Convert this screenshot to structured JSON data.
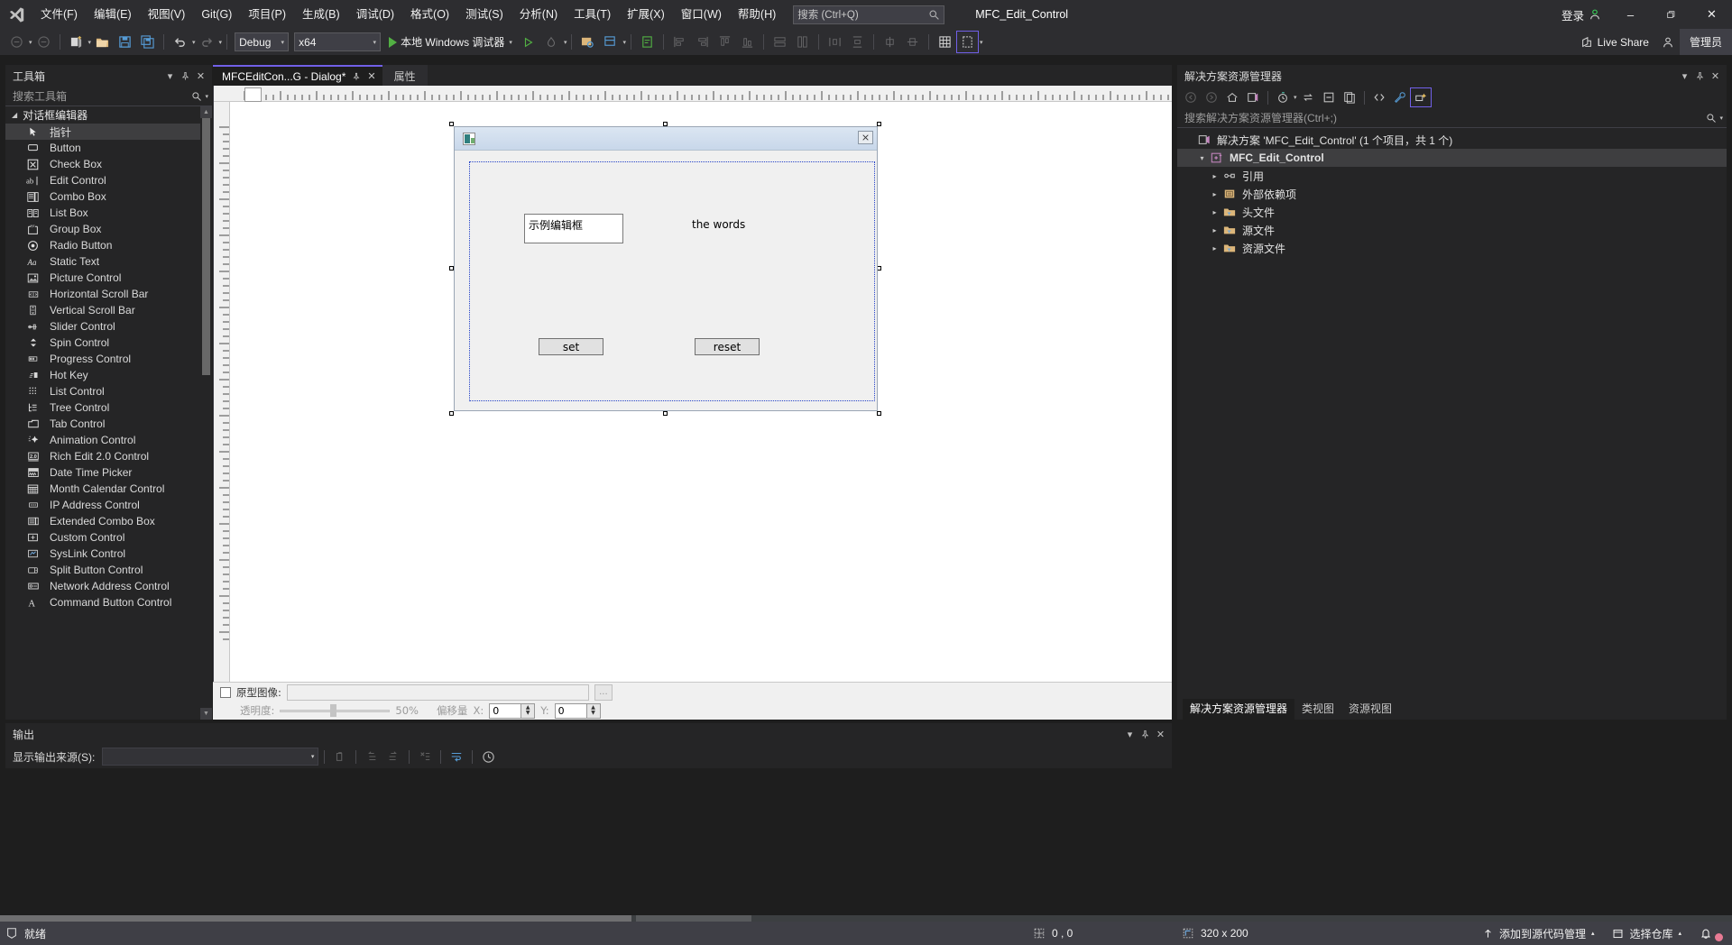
{
  "app": {
    "window_title": "MFC_Edit_Control",
    "signin_label": "登录",
    "minimize": "–",
    "restore": "❐",
    "close": "✕"
  },
  "menubar": {
    "items": [
      "文件(F)",
      "编辑(E)",
      "视图(V)",
      "Git(G)",
      "项目(P)",
      "生成(B)",
      "调试(D)",
      "格式(O)",
      "测试(S)",
      "分析(N)",
      "工具(T)",
      "扩展(X)",
      "窗口(W)",
      "帮助(H)"
    ],
    "search_placeholder": "搜索 (Ctrl+Q)"
  },
  "toolbar": {
    "config": "Debug",
    "platform": "x64",
    "run_label": "本地 Windows 调试器",
    "live_share": "Live Share",
    "admin": "管理员"
  },
  "toolbox": {
    "title": "工具箱",
    "search_placeholder": "搜索工具箱",
    "group": "对话框编辑器",
    "items": [
      {
        "label": "指针",
        "icon": "pointer-icon",
        "selected": true
      },
      {
        "label": "Button",
        "icon": "button-icon",
        "selected": false
      },
      {
        "label": "Check Box",
        "icon": "checkbox-icon",
        "selected": false
      },
      {
        "label": "Edit Control",
        "icon": "edit-control-icon",
        "selected": false
      },
      {
        "label": "Combo Box",
        "icon": "combobox-icon",
        "selected": false
      },
      {
        "label": "List Box",
        "icon": "listbox-icon",
        "selected": false
      },
      {
        "label": "Group Box",
        "icon": "groupbox-icon",
        "selected": false
      },
      {
        "label": "Radio Button",
        "icon": "radio-button-icon",
        "selected": false
      },
      {
        "label": "Static Text",
        "icon": "static-text-icon",
        "selected": false
      },
      {
        "label": "Picture Control",
        "icon": "picture-control-icon",
        "selected": false
      },
      {
        "label": "Horizontal Scroll Bar",
        "icon": "hscrollbar-icon",
        "selected": false
      },
      {
        "label": "Vertical Scroll Bar",
        "icon": "vscrollbar-icon",
        "selected": false
      },
      {
        "label": "Slider Control",
        "icon": "slider-icon",
        "selected": false
      },
      {
        "label": "Spin Control",
        "icon": "spin-icon",
        "selected": false
      },
      {
        "label": "Progress Control",
        "icon": "progress-icon",
        "selected": false
      },
      {
        "label": "Hot Key",
        "icon": "hotkey-icon",
        "selected": false
      },
      {
        "label": "List Control",
        "icon": "list-control-icon",
        "selected": false
      },
      {
        "label": "Tree Control",
        "icon": "tree-control-icon",
        "selected": false
      },
      {
        "label": "Tab Control",
        "icon": "tab-control-icon",
        "selected": false
      },
      {
        "label": "Animation Control",
        "icon": "animation-icon",
        "selected": false
      },
      {
        "label": "Rich Edit 2.0 Control",
        "icon": "rich-edit-icon",
        "selected": false
      },
      {
        "label": "Date Time Picker",
        "icon": "datetime-picker-icon",
        "selected": false
      },
      {
        "label": "Month Calendar Control",
        "icon": "calendar-icon",
        "selected": false
      },
      {
        "label": "IP Address Control",
        "icon": "ip-address-icon",
        "selected": false
      },
      {
        "label": "Extended Combo Box",
        "icon": "ext-combobox-icon",
        "selected": false
      },
      {
        "label": "Custom Control",
        "icon": "custom-control-icon",
        "selected": false
      },
      {
        "label": "SysLink Control",
        "icon": "syslink-icon",
        "selected": false
      },
      {
        "label": "Split Button Control",
        "icon": "split-button-icon",
        "selected": false
      },
      {
        "label": "Network Address Control",
        "icon": "network-address-icon",
        "selected": false
      },
      {
        "label": "Command Button Control",
        "icon": "command-button-icon",
        "selected": false
      }
    ]
  },
  "editor": {
    "tabs": [
      {
        "label": "MFCEditCon...G - Dialog*",
        "active": true
      },
      {
        "label": "属性",
        "active": false
      }
    ],
    "dialog": {
      "title": "",
      "close_glyph": "✕",
      "edit_value": "示例编辑框",
      "static_text": "the words",
      "button_set": "set",
      "button_reset": "reset"
    },
    "image_props": {
      "checkbox_label": "原型图像:",
      "path_value": "",
      "browse_label": "...",
      "opacity_label": "透明度:",
      "opacity_value": "50%",
      "offset_label": "偏移量",
      "x_label": "X:",
      "x_value": "0",
      "y_label": "Y:",
      "y_value": "0"
    }
  },
  "solution_explorer": {
    "title": "解决方案资源管理器",
    "search_placeholder": "搜索解决方案资源管理器(Ctrl+;)",
    "tree": [
      {
        "label": "解决方案 'MFC_Edit_Control' (1 个项目，共 1 个)",
        "indent": 0,
        "icon": "solution-icon",
        "expander": "",
        "bold": false,
        "selected": false
      },
      {
        "label": "MFC_Edit_Control",
        "indent": 1,
        "icon": "cpp-project-icon",
        "expander": "▾",
        "bold": true,
        "selected": true
      },
      {
        "label": "引用",
        "indent": 2,
        "icon": "references-icon",
        "expander": "▸",
        "bold": false,
        "selected": false
      },
      {
        "label": "外部依赖项",
        "indent": 2,
        "icon": "external-deps-icon",
        "expander": "▸",
        "bold": false,
        "selected": false
      },
      {
        "label": "头文件",
        "indent": 2,
        "icon": "folder-icon",
        "expander": "▸",
        "bold": false,
        "selected": false
      },
      {
        "label": "源文件",
        "indent": 2,
        "icon": "folder-icon",
        "expander": "▸",
        "bold": false,
        "selected": false
      },
      {
        "label": "资源文件",
        "indent": 2,
        "icon": "folder-icon",
        "expander": "▸",
        "bold": false,
        "selected": false
      }
    ],
    "bottom_tabs": [
      {
        "label": "解决方案资源管理器",
        "active": true
      },
      {
        "label": "类视图",
        "active": false
      },
      {
        "label": "资源视图",
        "active": false
      }
    ]
  },
  "output": {
    "title": "输出",
    "source_label": "显示输出来源(S):",
    "source_value": "",
    "content": ""
  },
  "statusbar": {
    "status": "就绪",
    "coords": "0 , 0",
    "size": "320 x 200",
    "source_control": "添加到源代码管理",
    "repo": "选择仓库"
  },
  "colors": {
    "accent": "#7160e8",
    "chrome": "#2d2d30",
    "panel": "#252526",
    "editor_bg": "#1e1e1e",
    "status": "#3f3f46",
    "run_green": "#52b043",
    "dialog_border": "#2442c8"
  }
}
